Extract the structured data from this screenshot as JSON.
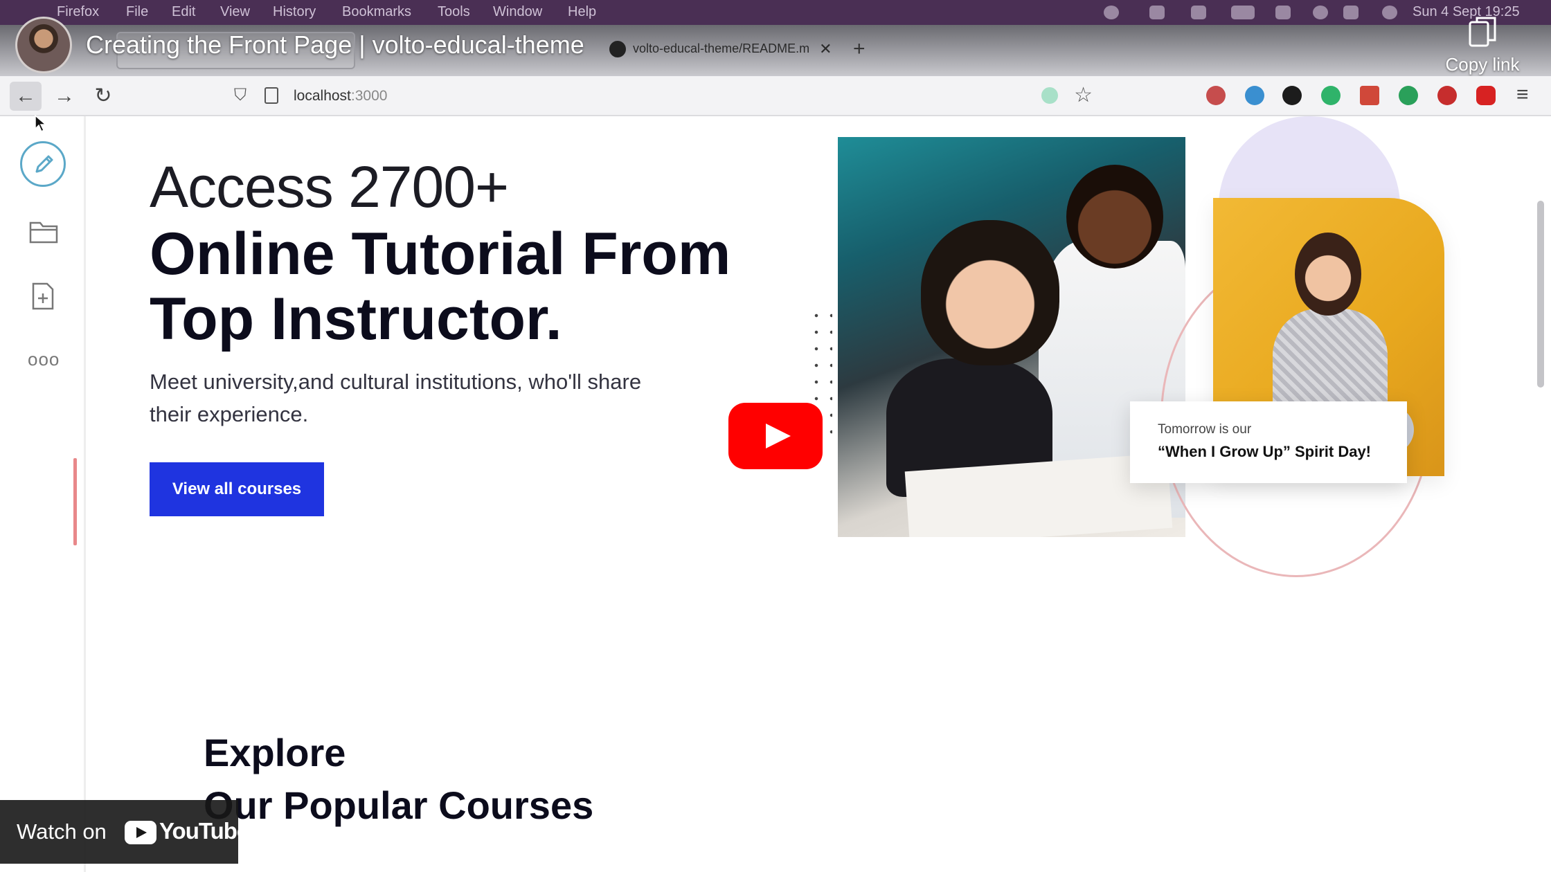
{
  "menubar": {
    "items": [
      "Firefox",
      "File",
      "Edit",
      "View",
      "History",
      "Bookmarks",
      "Tools",
      "Window",
      "Help"
    ],
    "clock": "Sun 4 Sept  19:25"
  },
  "tabs": {
    "second_tab_label": "volto-educal-theme/README.m",
    "close_glyph": "✕",
    "new_tab_glyph": "+"
  },
  "overlay": {
    "video_title": "Creating the Front Page | volto-educal-theme",
    "copy_link": "Copy link",
    "watch_on": "Watch on",
    "youtube_word": "YouTube"
  },
  "navbar": {
    "url_host": "localhost",
    "url_port": ":3000",
    "back_glyph": "←",
    "forward_glyph": "→",
    "reload_glyph": "↻",
    "star_glyph": "☆",
    "menu_glyph": "≡",
    "extension_colors": [
      "#c64d4d",
      "#3a8fd0",
      "#1c1c1c",
      "#2fb36a",
      "#d0483a",
      "#2aa05a",
      "#c62d2d",
      "#d72222"
    ]
  },
  "toolbar": {
    "more_glyph": "ooo"
  },
  "hero": {
    "pre": "Access 2700+",
    "title": "Online Tutorial From Top Instructor.",
    "description": "Meet university,and cultural institutions, who'll share their experience.",
    "cta_label": "View all courses"
  },
  "card": {
    "line1": "Tomorrow is our",
    "line2": "“When I Grow Up” Spirit Day!"
  },
  "explore": {
    "line1": "Explore",
    "line2": "Our Popular Courses"
  },
  "colors": {
    "cta": "#1f34e0",
    "play": "#ff0000",
    "accent_side_photo": "#f2b935",
    "circle_top": "#e7e3f7",
    "ring": "#eab7b9"
  }
}
